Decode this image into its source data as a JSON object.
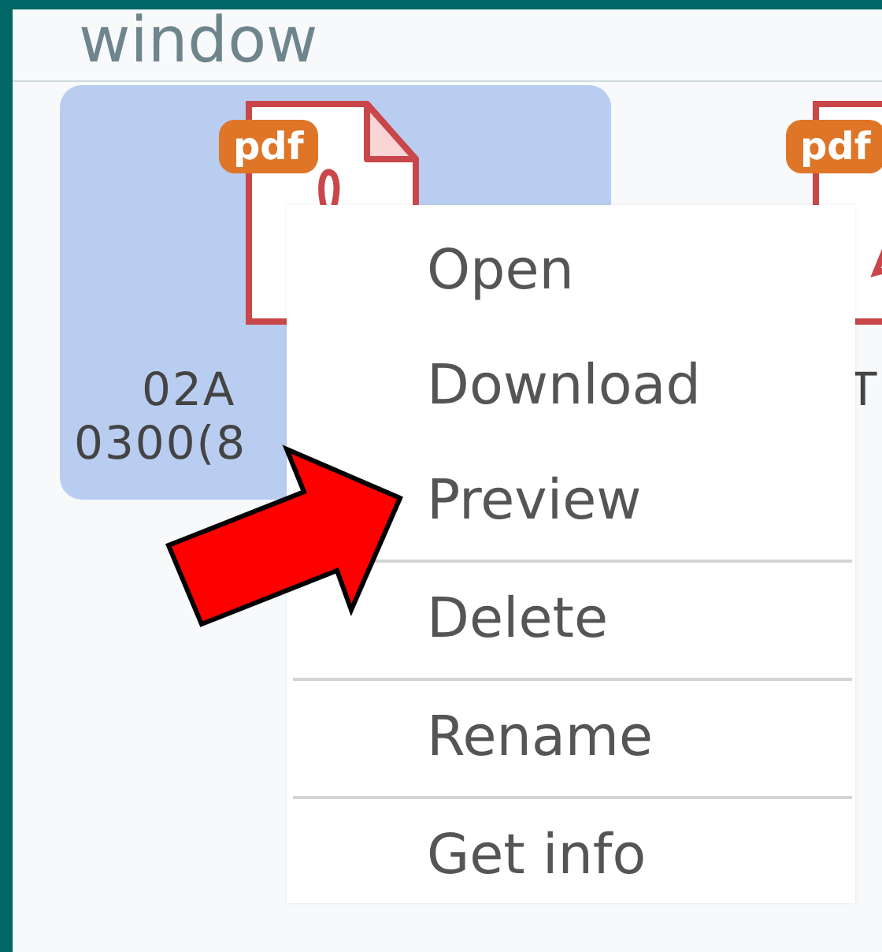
{
  "window": {
    "title": "window"
  },
  "files": [
    {
      "badge": "pdf",
      "name_lines": [
        "02A",
        "0300(8"
      ],
      "selected": true
    },
    {
      "badge": "pdf",
      "name_lines": [
        "T"
      ],
      "selected": false
    }
  ],
  "context_menu": {
    "groups": [
      [
        "Open",
        "Download",
        "Preview"
      ],
      [
        "Delete"
      ],
      [
        "Rename"
      ],
      [
        "Get info"
      ]
    ]
  },
  "annotation": {
    "kind": "arrow"
  }
}
